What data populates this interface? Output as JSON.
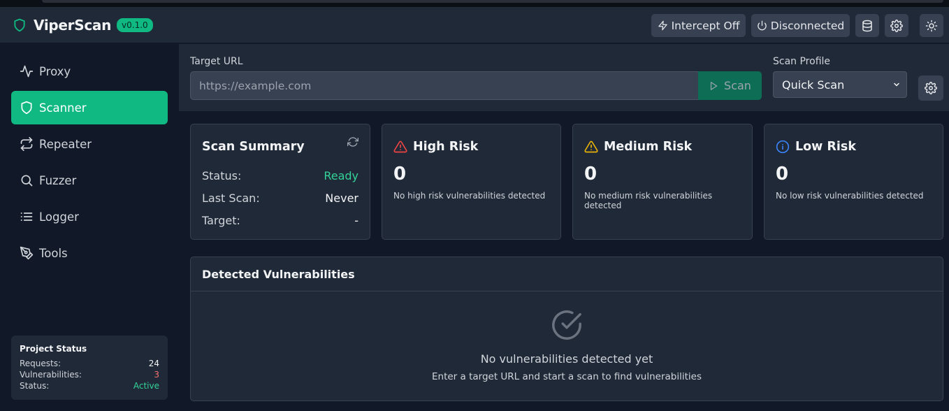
{
  "app": {
    "name": "ViperScan",
    "version": "v0.1.0"
  },
  "header": {
    "intercept_label": "Intercept Off",
    "connection_label": "Disconnected"
  },
  "sidebar": {
    "items": [
      {
        "label": "Proxy",
        "icon": "activity-icon"
      },
      {
        "label": "Scanner",
        "icon": "shield-icon",
        "active": true
      },
      {
        "label": "Repeater",
        "icon": "repeat-icon"
      },
      {
        "label": "Fuzzer",
        "icon": "search-icon"
      },
      {
        "label": "Logger",
        "icon": "list-icon"
      },
      {
        "label": "Tools",
        "icon": "pen-tool-icon"
      }
    ],
    "project_status": {
      "title": "Project Status",
      "requests_label": "Requests:",
      "requests_value": "24",
      "vulns_label": "Vulnerabilities:",
      "vulns_value": "3",
      "status_label": "Status:",
      "status_value": "Active"
    }
  },
  "scan_bar": {
    "target_label": "Target URL",
    "target_placeholder": "https://example.com",
    "scan_button": "Scan",
    "profile_label": "Scan Profile",
    "profile_value": "Quick Scan"
  },
  "summary": {
    "title": "Scan Summary",
    "status_label": "Status:",
    "status_value": "Ready",
    "last_scan_label": "Last Scan:",
    "last_scan_value": "Never",
    "target_label": "Target:",
    "target_value": "-"
  },
  "risks": {
    "high": {
      "title": "High Risk",
      "count": "0",
      "desc": "No high risk vulnerabilities detected",
      "color": "#ef4444"
    },
    "medium": {
      "title": "Medium Risk",
      "count": "0",
      "desc": "No medium risk vulnerabilities detected",
      "color": "#eab308"
    },
    "low": {
      "title": "Low Risk",
      "count": "0",
      "desc": "No low risk vulnerabilities detected",
      "color": "#3b82f6"
    }
  },
  "vulnerabilities": {
    "title": "Detected Vulnerabilities",
    "empty_title": "No vulnerabilities detected yet",
    "empty_hint": "Enter a target URL and start a scan to find vulnerabilities"
  },
  "colors": {
    "accent": "#10b981",
    "ready": "#34d399",
    "danger": "#f87171"
  }
}
